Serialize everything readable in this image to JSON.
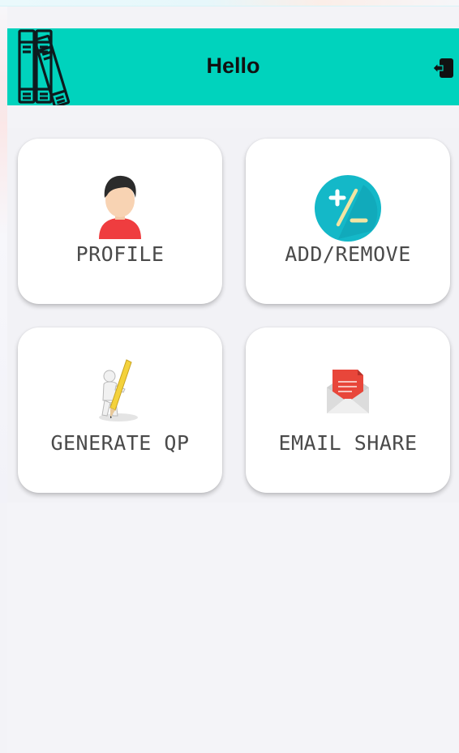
{
  "header": {
    "title": "Hello"
  },
  "dashboard": {
    "cards": [
      {
        "label": "PROFILE",
        "icon": "profile-avatar-icon"
      },
      {
        "label": "ADD/REMOVE",
        "icon": "plus-minus-icon"
      },
      {
        "label": "GENERATE QP",
        "icon": "pencil-figure-icon"
      },
      {
        "label": "EMAIL SHARE",
        "icon": "envelope-letter-icon"
      }
    ]
  },
  "colors": {
    "app_bar": "#00d3bd",
    "background": "#f3f3f7",
    "card": "#ffffff",
    "label_text": "#4a4a4a"
  }
}
